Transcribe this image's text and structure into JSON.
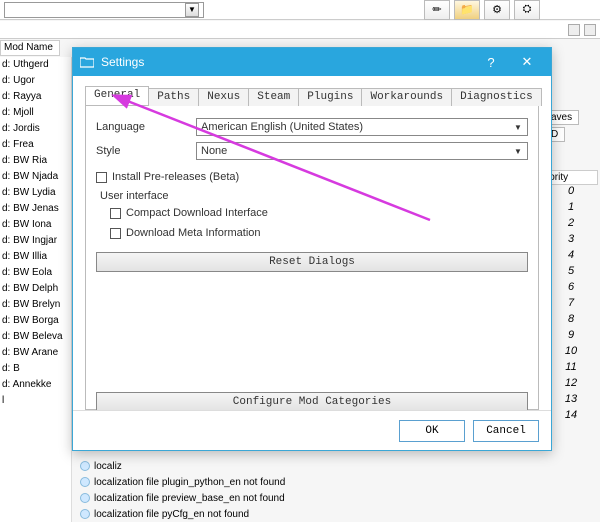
{
  "bg": {
    "combo_value": "",
    "header": "Mod Name",
    "list": [
      "d: Uthgerd",
      "d: Ugor",
      "d: Rayya",
      "d: Mjoll",
      "d: Jordis",
      "d: Frea",
      "d: BW Ria",
      "d: BW Njada",
      "d: BW Lydia",
      "d: BW Jenas",
      "d: BW Iona",
      "d: BW Ingjar",
      "d: BW Illia",
      "d: BW Eola",
      "d: BW Delph",
      "d: BW Brelyn",
      "d: BW Borga",
      "d: BW Beleva",
      "d: BW Arane",
      "d: B",
      "d: Annekke",
      "l"
    ],
    "right_tabs": {
      "aves": "aves",
      "d": "D"
    },
    "priority_header": "iority",
    "priorities": [
      "0",
      "1",
      "2",
      "3",
      "4",
      "5",
      "6",
      "7",
      "8",
      "9",
      "10",
      "11",
      "12",
      "13",
      "14"
    ],
    "notes": [
      "localiz",
      "localization file plugin_python_en not found",
      "localization file preview_base_en not found",
      "localization file pyCfg_en not found"
    ]
  },
  "dialog": {
    "title": "Settings",
    "tabs": [
      "General",
      "Paths",
      "Nexus",
      "Steam",
      "Plugins",
      "Workarounds",
      "Diagnostics"
    ],
    "active_tab": "General",
    "general": {
      "language_label": "Language",
      "language_value": "American English (United States)",
      "style_label": "Style",
      "style_value": "None",
      "install_prerelease": "Install Pre-releases (Beta)",
      "ui_header": "User interface",
      "compact_dl": "Compact Download Interface",
      "dl_meta": "Download Meta Information",
      "reset_dialogs": "Reset Dialogs",
      "configure_cats": "Configure Mod Categories"
    },
    "ok": "OK",
    "cancel": "Cancel",
    "help": "?"
  }
}
